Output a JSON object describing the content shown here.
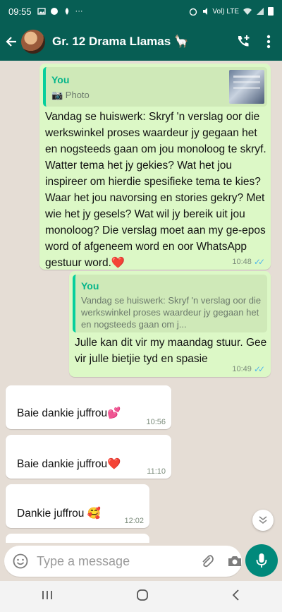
{
  "status_bar": {
    "time": "09:55",
    "left_icons": [
      "image-icon",
      "circle-icon",
      "notification-icon"
    ],
    "more": "···",
    "network": "Vol) LTE"
  },
  "header": {
    "title": "Gr. 12 Drama Llamas 🦙",
    "back_icon": "back-arrow-icon",
    "call_icon": "add-call-icon",
    "menu_icon": "more-vert-icon"
  },
  "messages": [
    {
      "type": "outgoing",
      "quote": {
        "sender": "You",
        "subtitle": "📷 Photo"
      },
      "text": "Vandag se huiswerk: Skryf 'n verslag oor die werkswinkel proses waardeur jy gegaan het en nogsteeds gaan om jou monoloog te skryf. Watter tema het jy gekies? Wat het jou inspireer om hierdie spesifieke tema te kies? Waar het jou navorsing en stories gekry? Met wie het jy gesels? Wat wil jy bereik uit jou monoloog? Die verslag moet aan my ge-epos word of afgeneem word en oor WhatsApp gestuur word.",
      "emoji": "❤️",
      "time": "10:48",
      "ticks": "✓✓"
    },
    {
      "type": "outgoing",
      "quote": {
        "sender": "You",
        "subtitle": "Vandag se huiswerk: Skryf 'n verslag oor die werkswinkel proses waardeur jy gegaan het en nogsteeds gaan om j..."
      },
      "text": "Julle kan dit vir my maandag stuur. Gee vir julle bietjie tyd en spasie",
      "time": "10:49",
      "ticks": "✓✓"
    },
    {
      "type": "incoming",
      "text": "Baie dankie juffrou",
      "emoji": "💕",
      "time": "10:56"
    },
    {
      "type": "incoming",
      "text": "Baie dankie juffrou",
      "emoji": "❤️",
      "time": "11:10"
    },
    {
      "type": "incoming",
      "text": "Dankie juffrou ",
      "emoji": "🥰",
      "time": "12:02"
    }
  ],
  "composer": {
    "placeholder": "Type a message",
    "emoji_icon": "emoji-icon",
    "attach_icon": "attach-icon",
    "camera_icon": "camera-icon",
    "mic_icon": "mic-icon"
  },
  "nav": {
    "recents": "|||",
    "home": "○",
    "back": "<"
  },
  "colors": {
    "header": "#075e54",
    "outgoing_bubble": "#dcf8c6",
    "incoming_bubble": "#ffffff",
    "accent": "#00897b",
    "ticks": "#4fb6ec"
  }
}
